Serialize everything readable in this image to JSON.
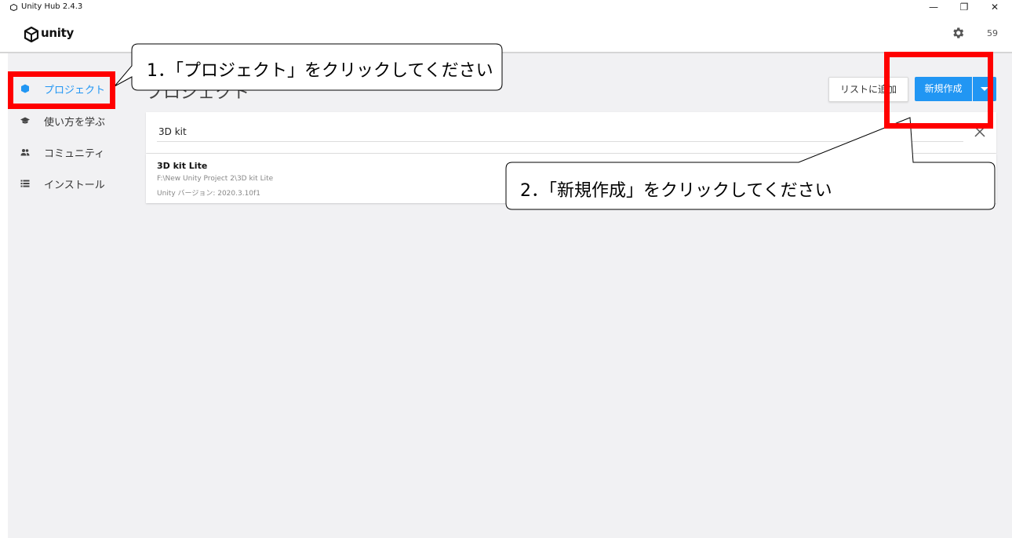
{
  "window": {
    "title": "Unity Hub 2.4.3",
    "minimize_symbol": "—",
    "maximize_symbol": "❐",
    "close_symbol": "✕"
  },
  "header": {
    "logo_text": "unity",
    "settings_icon": "gear-icon",
    "counter": "59"
  },
  "sidebar": {
    "items": [
      {
        "label": "プロジェクト",
        "icon": "cube-icon",
        "active": true
      },
      {
        "label": "使い方を学ぶ",
        "icon": "graduation-cap-icon",
        "active": false
      },
      {
        "label": "コミュニティ",
        "icon": "people-icon",
        "active": false
      },
      {
        "label": "インストール",
        "icon": "list-icon",
        "active": false
      }
    ]
  },
  "main": {
    "page_title": "プロジェクト",
    "add_button_label": "リストに追加",
    "new_button_label": "新規作成",
    "search": {
      "value": "3D kit"
    },
    "projects": [
      {
        "name": "3D kit Lite",
        "path": "F:\\New Unity Project 2\\3D kit Lite",
        "version": "Unity バージョン: 2020.3.10f1"
      }
    ]
  },
  "annotations": {
    "callout1": "1．「プロジェクト」をクリックしてください",
    "callout2": "2．「新規作成」をクリックしてください"
  },
  "colors": {
    "accent": "#2196f3",
    "highlight": "#ff0000",
    "background": "#f1f1f3"
  }
}
